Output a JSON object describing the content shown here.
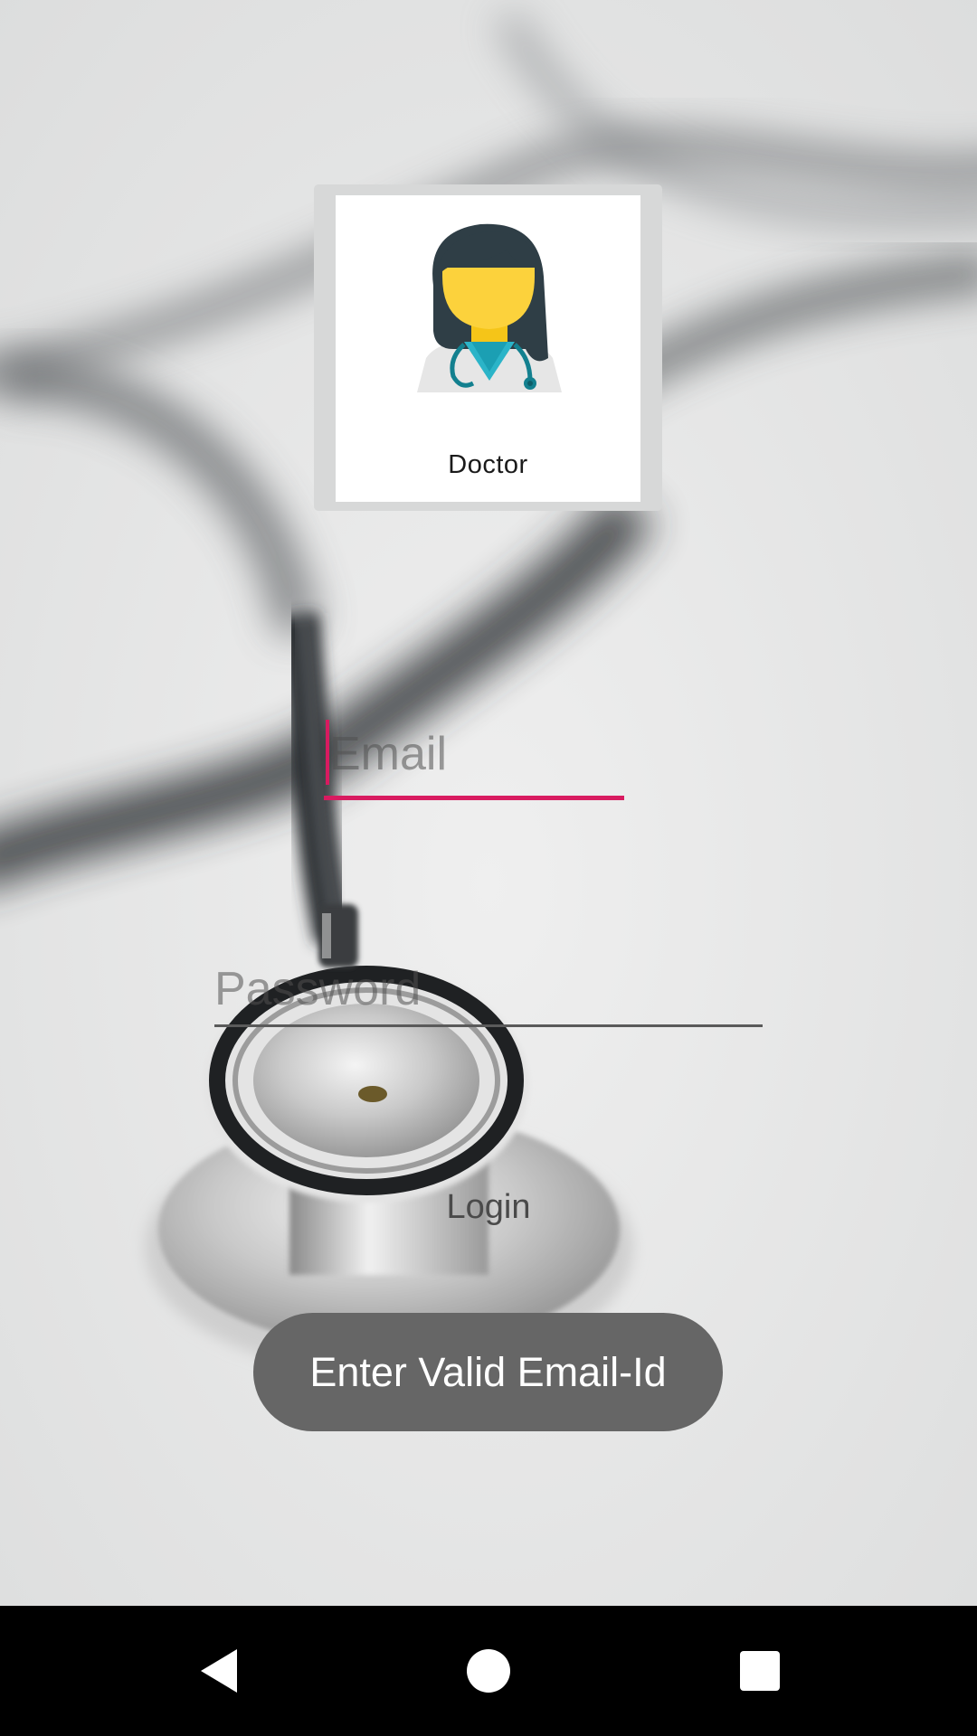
{
  "profile": {
    "label": "Doctor",
    "avatar_icon": "doctor-avatar-icon"
  },
  "form": {
    "email_placeholder": "Email",
    "password_placeholder": "Password",
    "login_label": "Login"
  },
  "toast": {
    "message": "Enter Valid Email-Id"
  },
  "nav": {
    "back_icon": "back-triangle-icon",
    "home_icon": "home-circle-icon",
    "recents_icon": "recents-square-icon"
  },
  "colors": {
    "accent": "#d81b60",
    "toast_bg": "#666666",
    "nav_bg": "#000000"
  }
}
